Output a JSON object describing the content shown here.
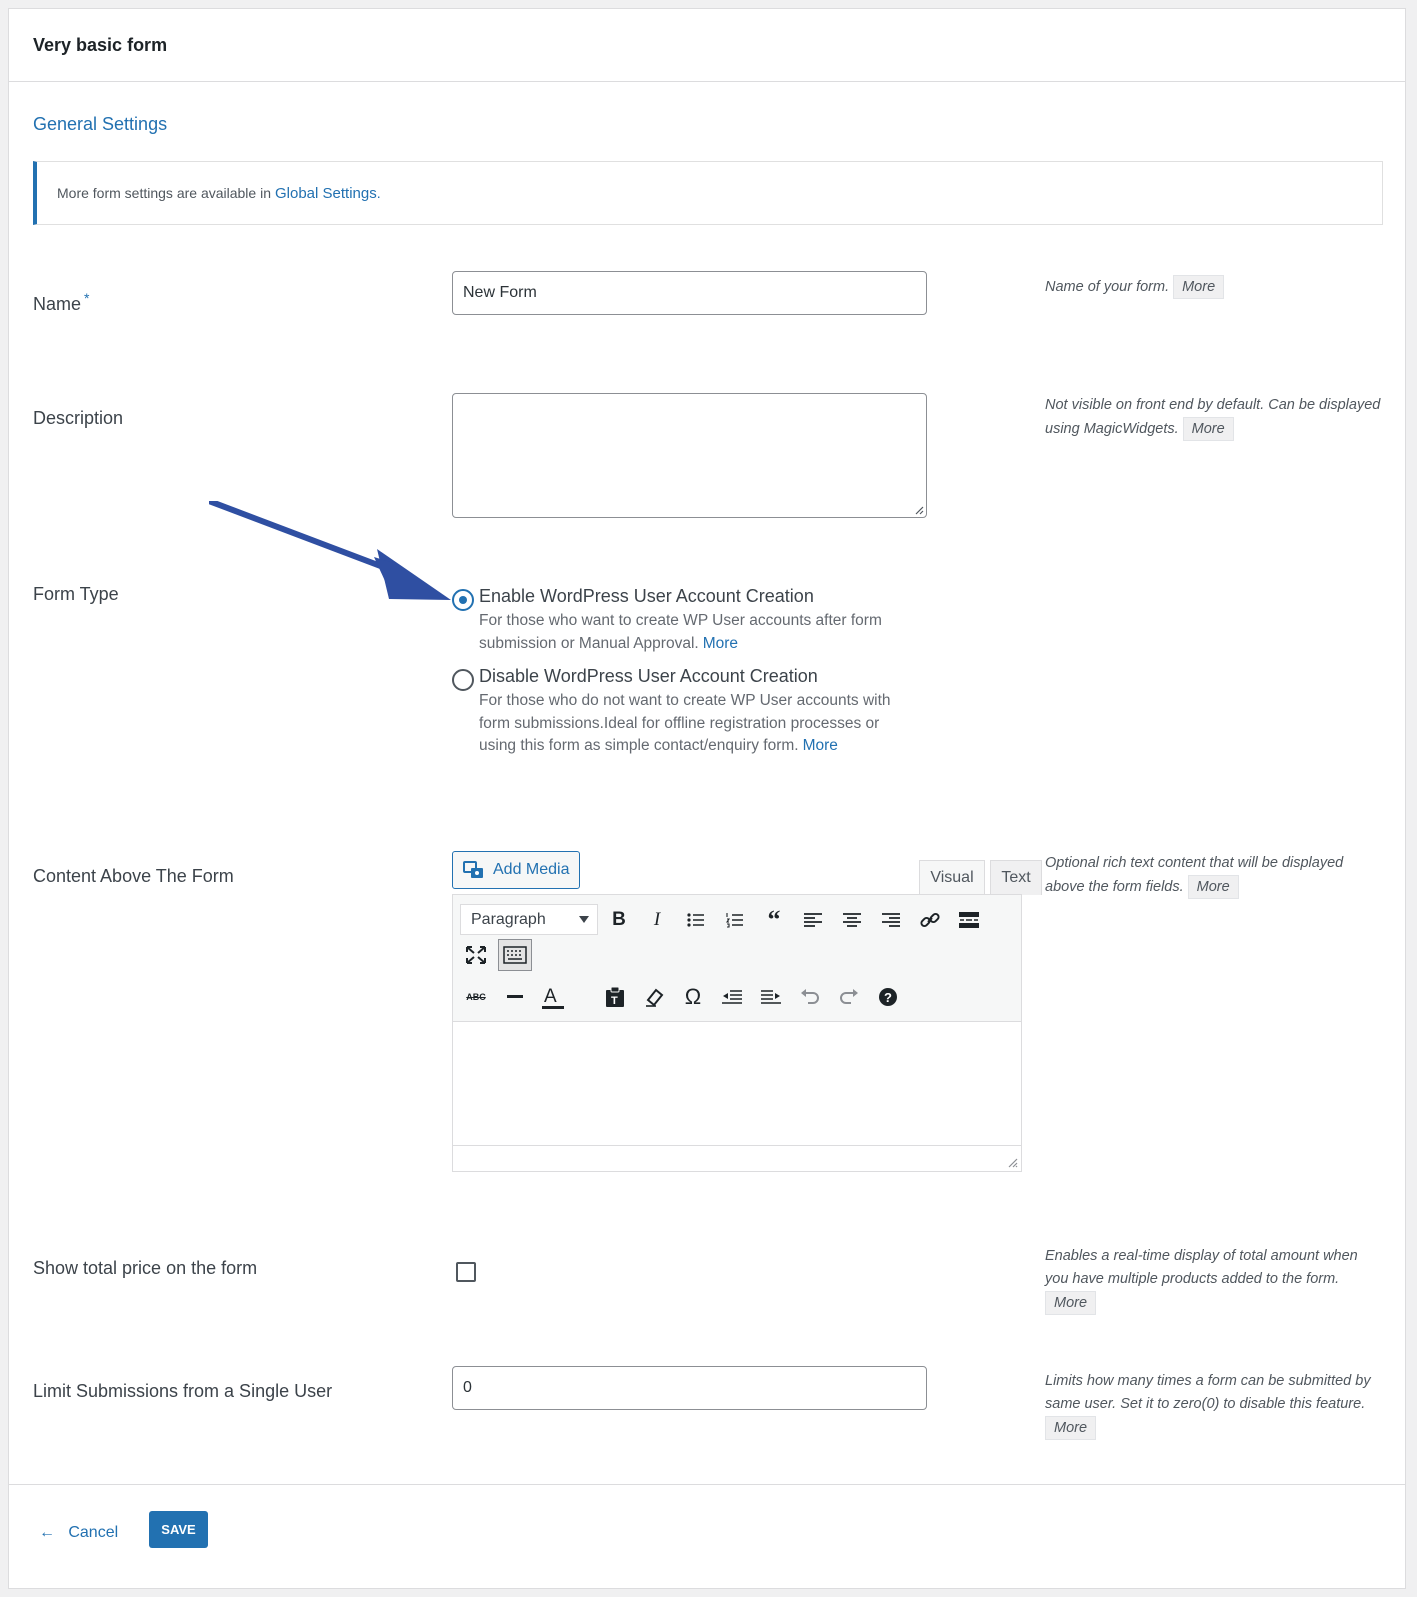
{
  "form_title": "Very basic form",
  "section_title": "General Settings",
  "notice": {
    "text": "More form settings are available in",
    "link": "Global Settings",
    "suffix": "."
  },
  "fields": {
    "name": {
      "label": "Name",
      "required_mark": "*",
      "value": "New Form",
      "help": "Name of your form.",
      "more": "More"
    },
    "description": {
      "label": "Description",
      "value": "",
      "help": "Not visible on front end by default. Can be displayed using MagicWidgets.",
      "more": "More"
    },
    "form_type": {
      "label": "Form Type",
      "options": [
        {
          "title": "Enable WordPress User Account Creation",
          "desc": "For those who want to create WP User accounts after form submission or Manual Approval.",
          "more": "More",
          "checked": true
        },
        {
          "title": "Disable WordPress User Account Creation",
          "desc": "For those who do not want to create WP User accounts with form submissions.Ideal for offline registration processes or using this form as simple contact/enquiry form.",
          "more": "More",
          "checked": false
        }
      ]
    },
    "content_above": {
      "label": "Content Above The Form",
      "add_media": "Add Media",
      "tabs": [
        "Visual",
        "Text"
      ],
      "format_select": "Paragraph",
      "help": "Optional rich text content that will be displayed above the form fields.",
      "more": "More",
      "toolbar_icons": [
        "bold-icon",
        "italic-icon",
        "bullet-list-icon",
        "numbered-list-icon",
        "blockquote-icon",
        "align-left-icon",
        "align-center-icon",
        "align-right-icon",
        "link-icon",
        "read-more-icon",
        "fullscreen-icon",
        "toolbar-toggle-icon",
        "strikethrough-icon",
        "horizontal-line-icon",
        "text-color-icon",
        "paste-text-icon",
        "clear-formatting-icon",
        "special-character-icon",
        "outdent-icon",
        "indent-icon",
        "undo-icon",
        "redo-icon",
        "help-icon"
      ]
    },
    "show_total": {
      "label": "Show total price on the form",
      "checked": false,
      "help": "Enables a real-time display of total amount when you have multiple products added to the form.",
      "more": "More"
    },
    "limit_submissions": {
      "label": "Limit Submissions from a Single User",
      "value": "0",
      "help": "Limits how many times a form can be submitted by same user. Set it to zero(0) to disable this feature.",
      "more": "More"
    }
  },
  "footer": {
    "cancel_arrow": "←",
    "cancel": "Cancel",
    "save": "SAVE"
  },
  "colors": {
    "accent": "#2271b1",
    "annotation_arrow": "#2f4fa2"
  }
}
